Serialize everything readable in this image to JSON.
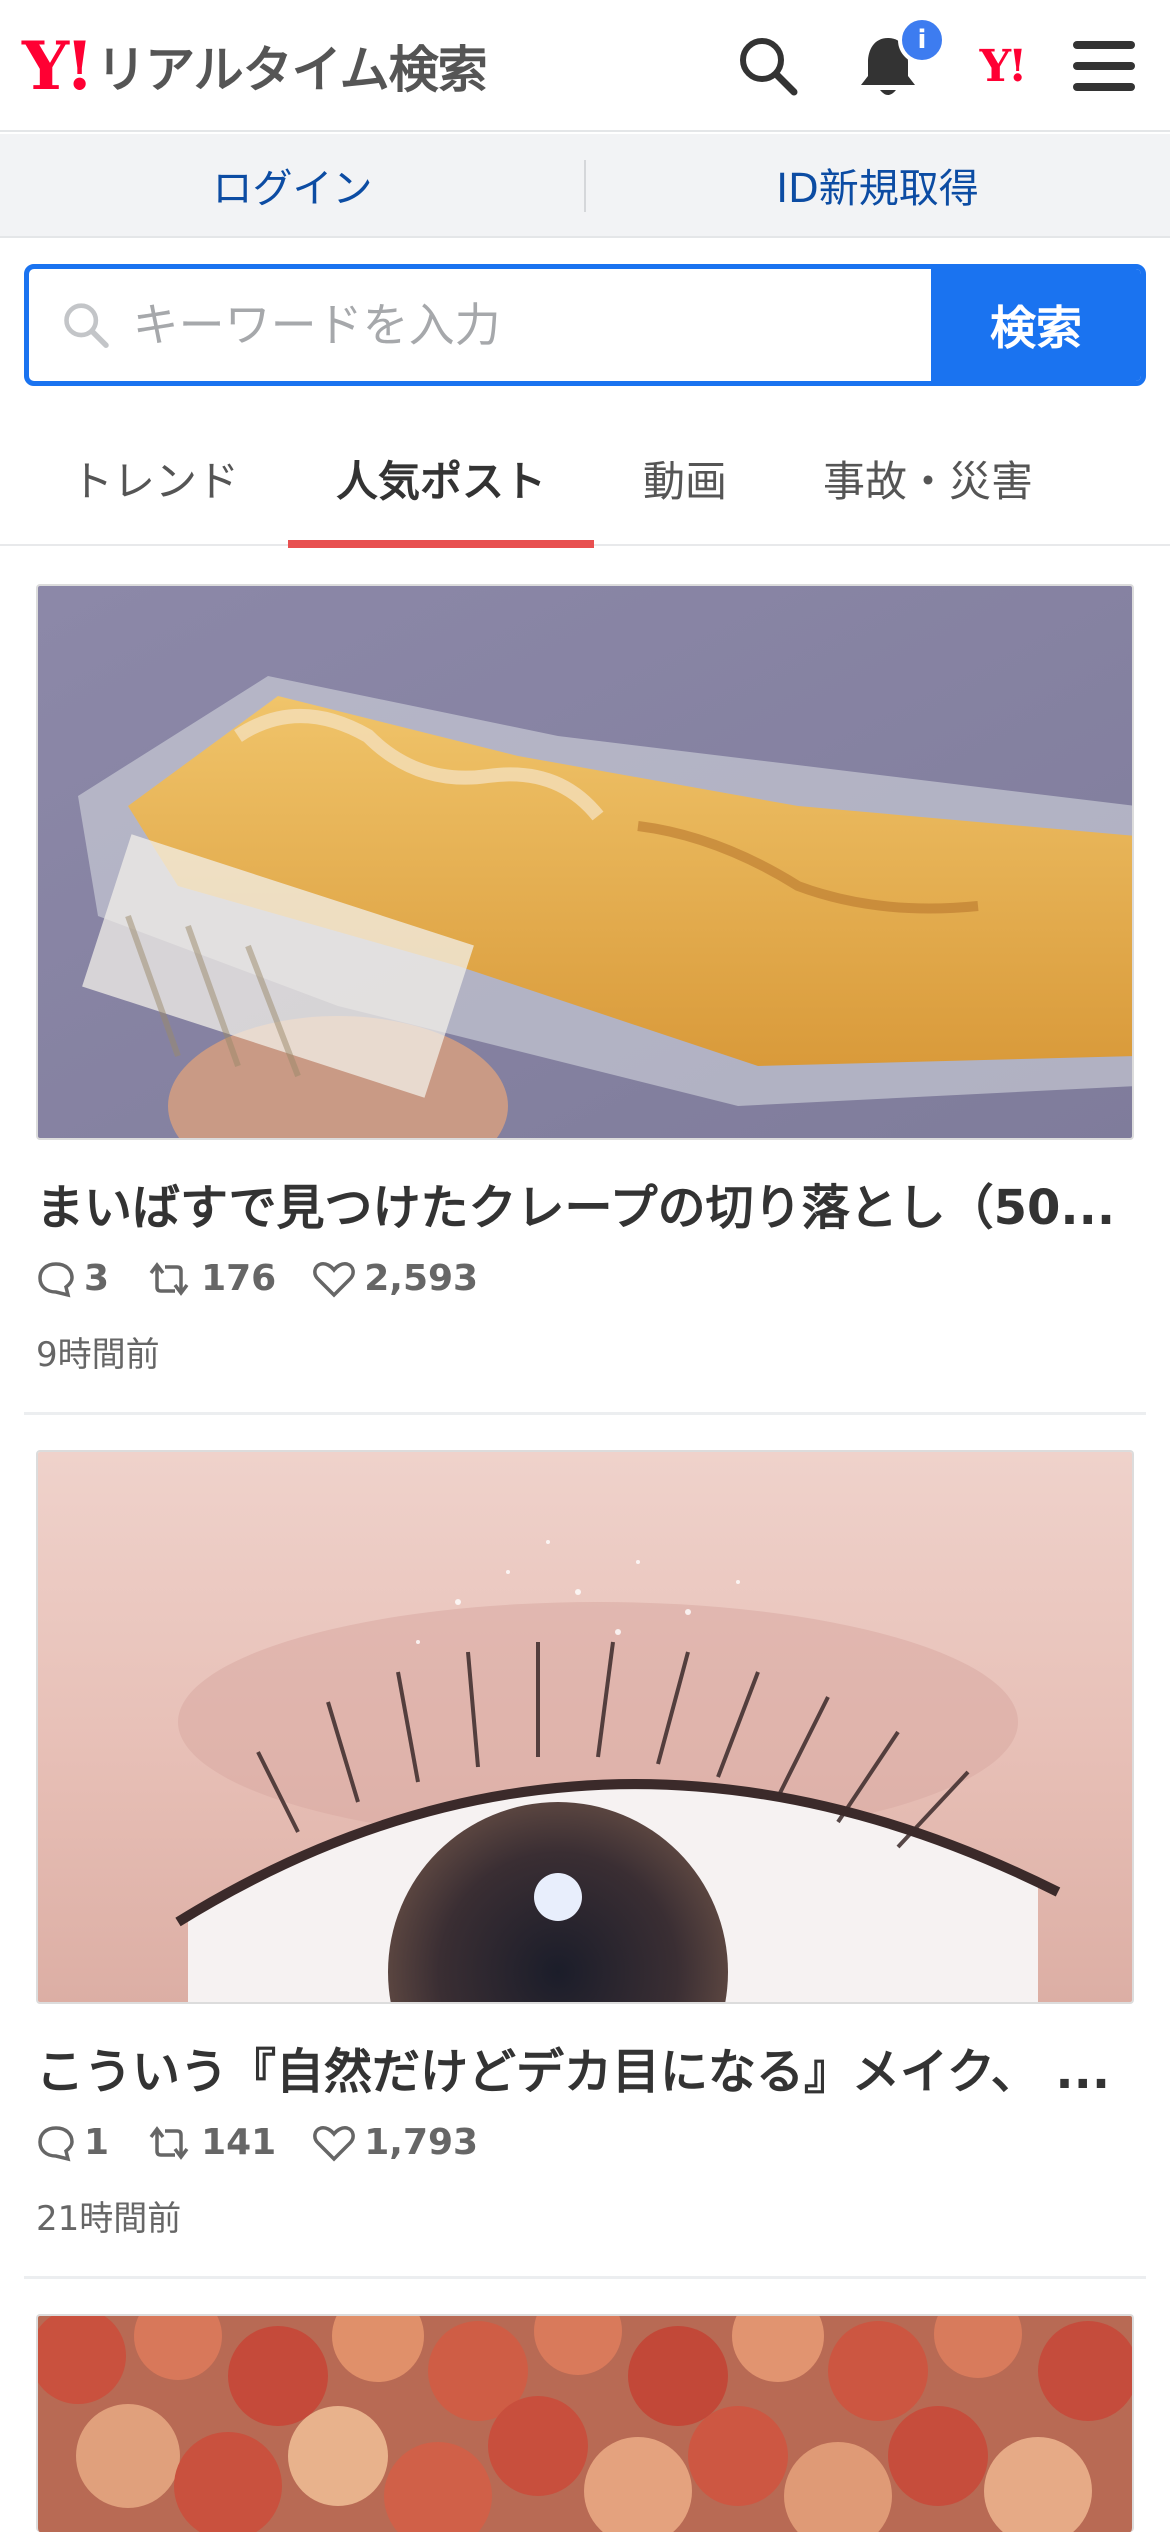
{
  "header": {
    "logo_mark": "Y!",
    "logo_text": "リアルタイム検索",
    "notification_badge": "i",
    "yj_mark": "Y!",
    "icons": [
      "search-icon",
      "bell-icon",
      "yahoo-japan-icon",
      "hamburger-menu-icon"
    ]
  },
  "loginbar": {
    "login": "ログイン",
    "signup": "ID新規取得"
  },
  "search": {
    "placeholder": "キーワードを入力",
    "button": "検索"
  },
  "tabs": [
    {
      "label": "トレンド",
      "active": false
    },
    {
      "label": "人気ポスト",
      "active": true
    },
    {
      "label": "動画",
      "active": false
    },
    {
      "label": "事故・災害",
      "active": false
    }
  ],
  "posts": [
    {
      "title": "まいばすで見つけたクレープの切り落とし（50...",
      "replies": "3",
      "reposts": "176",
      "likes": "2,593",
      "time": "9時間前"
    },
    {
      "title": "こういう『自然だけどデカ目になる』メイク、 ...",
      "replies": "1",
      "reposts": "141",
      "likes": "1,793",
      "time": "21時間前"
    }
  ],
  "colors": {
    "brand_red": "#ff0033",
    "accent_blue": "#1a73f0",
    "tab_underline": "#e85050",
    "link_blue": "#0c4ca3"
  }
}
